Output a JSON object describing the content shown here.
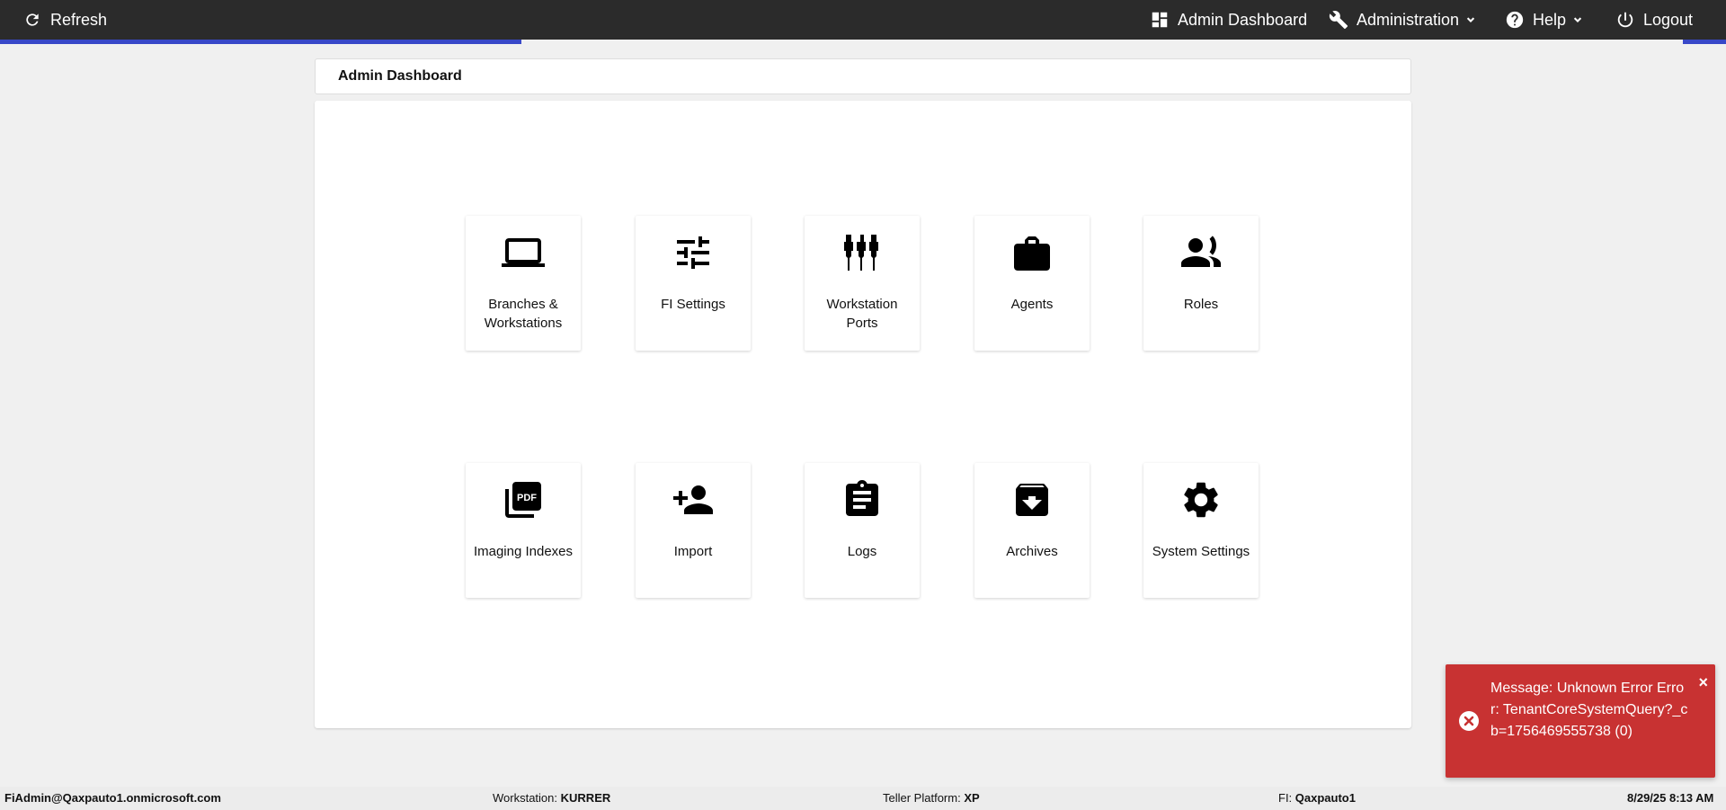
{
  "topbar": {
    "refresh_label": "Refresh",
    "admin_dashboard_label": "Admin Dashboard",
    "administration_label": "Administration",
    "help_label": "Help",
    "logout_label": "Logout"
  },
  "breadcrumb": {
    "title": "Admin Dashboard"
  },
  "tiles": [
    {
      "label": "Branches & Workstations",
      "icon": "laptop-icon"
    },
    {
      "label": "FI Settings",
      "icon": "sliders-icon"
    },
    {
      "label": "Workstation Ports",
      "icon": "ports-icon"
    },
    {
      "label": "Agents",
      "icon": "briefcase-icon"
    },
    {
      "label": "Roles",
      "icon": "people-icon"
    },
    {
      "label": "Imaging Indexes",
      "icon": "pdf-icon"
    },
    {
      "label": "Import",
      "icon": "add-person-icon"
    },
    {
      "label": "Logs",
      "icon": "clipboard-icon"
    },
    {
      "label": "Archives",
      "icon": "archive-icon"
    },
    {
      "label": "System Settings",
      "icon": "gear-icon"
    }
  ],
  "toast": {
    "message": "Message: Unknown Error Error: TenantCoreSystemQuery?_cb=1756469555738 (0)",
    "close": "×",
    "color": "#c83232"
  },
  "footer": {
    "user": "FiAdmin@Qaxpauto1.onmicrosoft.com",
    "workstation_label": "Workstation:",
    "workstation_value": "KURRER",
    "platform_label": "Teller Platform:",
    "platform_value": "XP",
    "fi_label": "FI:",
    "fi_value": "Qaxpauto1",
    "datetime": "8/29/25 8:13 AM"
  },
  "colors": {
    "topbar": "#2b2b2b",
    "accent": "#3848c8",
    "error": "#c83232"
  }
}
